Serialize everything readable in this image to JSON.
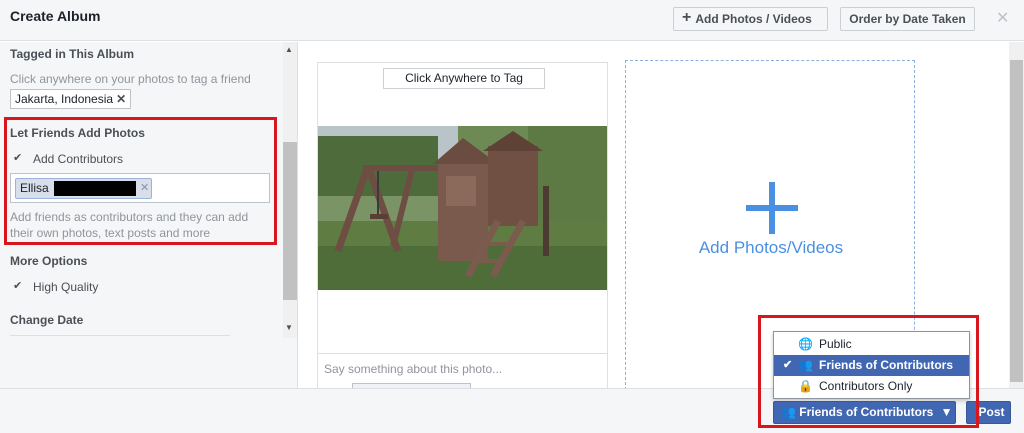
{
  "header": {
    "title": "Create Album",
    "add_photos_label": "Add Photos / Videos",
    "order_label": "Order by Date Taken"
  },
  "sidebar": {
    "tagged_heading": "Tagged in This Album",
    "tag_hint": "Click anywhere on your photos to tag a friend",
    "location_chip": "Jakarta, Indonesia",
    "friends_heading": "Let Friends Add Photos",
    "add_contributors_label": "Add Contributors",
    "add_contributors_checked": true,
    "contributor_token": "Ellisa",
    "contributors_hint_1": "Add friends as contributors and they can add",
    "contributors_hint_2": "their own photos, text posts and more",
    "more_options_heading": "More Options",
    "high_quality_label": "High Quality",
    "high_quality_checked": true,
    "change_date_heading": "Change Date"
  },
  "main": {
    "tag_button": "Click Anywhere to Tag",
    "caption_placeholder": "Say something about this photo...",
    "add_zone_label": "Add Photos/Videos"
  },
  "privacy_menu": {
    "options": [
      {
        "label": "Public",
        "icon": "globe-icon",
        "selected": false
      },
      {
        "label": "Friends of Contributors",
        "icon": "friends-icon",
        "selected": true
      },
      {
        "label": "Contributors Only",
        "icon": "lock-icon",
        "selected": false
      }
    ]
  },
  "footer": {
    "privacy_label": "Friends of Contributors",
    "post_label": "Post"
  },
  "colors": {
    "accent": "#4267b2",
    "highlight": "#d9151d",
    "add_zone": "#4a90e2"
  }
}
